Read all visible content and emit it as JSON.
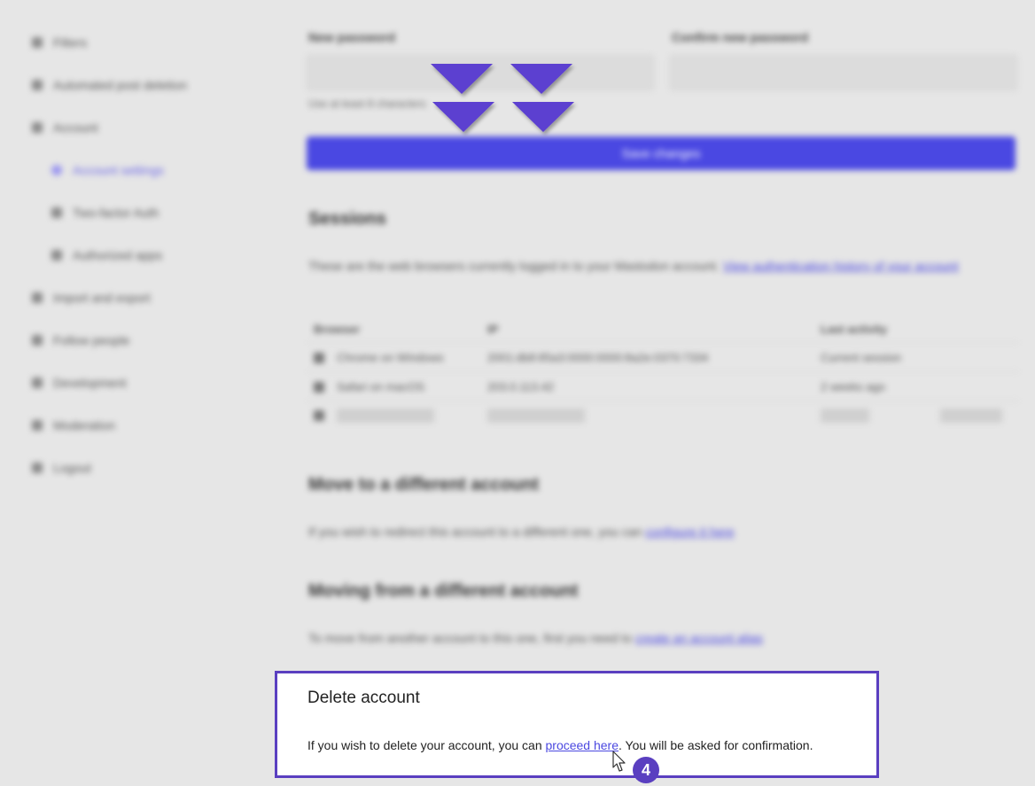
{
  "sidebar": {
    "items": [
      {
        "label": "Filters",
        "icon": "filter-icon"
      },
      {
        "label": "Automated post deletion",
        "icon": "trash-icon"
      },
      {
        "label": "Account",
        "icon": "user-icon"
      },
      {
        "label": "Account settings",
        "icon": "gear-icon"
      },
      {
        "label": "Two-factor Auth",
        "icon": "key-icon"
      },
      {
        "label": "Authorized apps",
        "icon": "apps-icon"
      },
      {
        "label": "Import and export",
        "icon": "cloud-icon"
      },
      {
        "label": "Follow people",
        "icon": "users-icon"
      },
      {
        "label": "Development",
        "icon": "code-icon"
      },
      {
        "label": "Moderation",
        "icon": "flag-icon"
      },
      {
        "label": "Logout",
        "icon": "logout-icon"
      }
    ]
  },
  "password": {
    "new_label": "New password",
    "confirm_label": "Confirm new password",
    "hint": "Use at least 8 characters",
    "save_label": "Save changes"
  },
  "sessions": {
    "heading": "Sessions",
    "intro": "These are the web browsers currently logged in to your Mastodon account.",
    "intro_link": "View authentication history of your account",
    "columns": [
      "Browser",
      "IP",
      "Last activity"
    ],
    "rows": [
      {
        "browser": "Chrome on Windows",
        "ip": "2001:db8:85a3:0000:0000:8a2e:0370:7334",
        "activity": "Current session"
      },
      {
        "browser": "Safari on macOS",
        "ip": "203.0.113.42",
        "activity": "2 weeks ago"
      }
    ]
  },
  "move_to": {
    "heading": "Move to a different account",
    "text": "If you wish to redirect this account to a different one, you can",
    "link": "configure it here"
  },
  "move_from": {
    "heading": "Moving from a different account",
    "text": "To move from another account to this one, first you need to",
    "link": "create an account alias"
  },
  "delete_panel": {
    "title": "Delete account",
    "text_before": "If you wish to delete your account, you can ",
    "link": "proceed here",
    "text_after": ". You will be asked for confirmation.",
    "step_number": "4"
  },
  "colors": {
    "accent": "#4a48e2",
    "highlight_border": "#5a3fc0",
    "arrow": "#5b3fd0"
  }
}
